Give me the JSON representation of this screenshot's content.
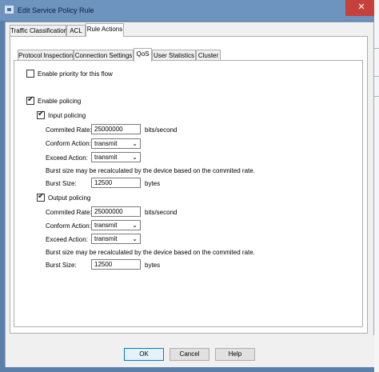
{
  "window": {
    "title": "Edit Service Policy Rule",
    "close_glyph": "✕"
  },
  "outer_tabs": [
    {
      "label": "Traffic Classification",
      "active": false
    },
    {
      "label": "ACL",
      "active": false
    },
    {
      "label": "Rule Actions",
      "active": true
    }
  ],
  "inner_tabs": [
    {
      "label": "Protocol Inspection",
      "active": false
    },
    {
      "label": "Connection Settings",
      "active": false
    },
    {
      "label": "QoS",
      "active": true
    },
    {
      "label": "User Statistics",
      "active": false
    },
    {
      "label": "Cluster",
      "active": false
    }
  ],
  "qos": {
    "enable_priority": {
      "label": "Enable priority for this flow",
      "checked": false
    },
    "enable_policing": {
      "label": "Enable policing",
      "checked": true
    },
    "input": {
      "label": "Input policing",
      "checked": true,
      "commited_rate_label": "Commited Rate:",
      "commited_rate_value": "25000000",
      "rate_unit": "bits/second",
      "conform_label": "Conform Action:",
      "conform_value": "transmit",
      "exceed_label": "Exceed Action:",
      "exceed_value": "transmit",
      "note": "Burst size may be recalculated by the device based on the commited rate.",
      "burst_label": "Burst Size:",
      "burst_value": "12500",
      "burst_unit": "bytes"
    },
    "output": {
      "label": "Output policing",
      "checked": true,
      "commited_rate_label": "Commited Rate:",
      "commited_rate_value": "25000000",
      "rate_unit": "bits/second",
      "conform_label": "Conform Action:",
      "conform_value": "transmit",
      "exceed_label": "Exceed Action:",
      "exceed_value": "transmit",
      "note": "Burst size may be recalculated by the device based on the commited rate.",
      "burst_label": "Burst Size:",
      "burst_value": "12500",
      "burst_unit": "bytes"
    }
  },
  "buttons": {
    "ok": "OK",
    "cancel": "Cancel",
    "help": "Help"
  },
  "colors": {
    "titlebar": "#6d93bf",
    "close": "#c6413b",
    "default_button_border": "#0078d7"
  }
}
